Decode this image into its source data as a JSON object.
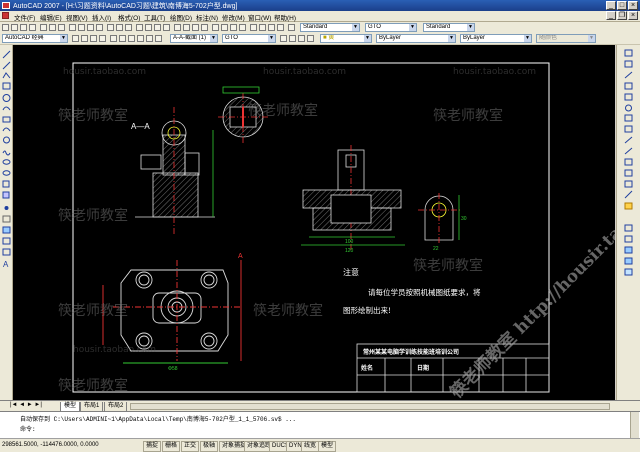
{
  "window": {
    "title": "AutoCAD 2007 - [H:\\习题资料\\AutoCAD习题\\建筑\\南博海5-702户型.dwg]",
    "buttons": [
      "_",
      "□",
      "×"
    ]
  },
  "menu": [
    "文件(F)",
    "编辑(E)",
    "视图(V)",
    "插入(I)",
    "格式(O)",
    "工具(T)",
    "绘图(D)",
    "标注(N)",
    "修改(M)",
    "窗口(W)",
    "帮助(H)"
  ],
  "toolbars": {
    "workspace": "AutoCAD 经典",
    "text_style": "Standard",
    "dim_style": "GTO",
    "table_style": "Standard",
    "layer": "0",
    "layer_state": "A-A-截面 (1)",
    "layer_current": "GTO",
    "color": "■ 黄",
    "linetype": "ByLayer",
    "lineweight": "ByLayer",
    "plotstyle": "随颜色"
  },
  "drawing": {
    "section_label": "A—A",
    "cut_marker": "A",
    "notes_title": "注意",
    "notes_line1": "请每位学员按照机械图纸要求，将",
    "notes_line2": "图形绘制出来!",
    "title_block": {
      "header": "常州某某电脑学训练技能班培训公司",
      "name_label": "姓名",
      "date_label": "日期"
    },
    "dims": {
      "plan_width": "Φ58",
      "front_width": "100",
      "front_base": "120",
      "side_width": "22",
      "side_height": "30"
    },
    "watermark_cn": "筷老师教室",
    "watermark_url": "housir.taobao.com",
    "watermark_big": "筷老师教室 http://housir.taobao.com"
  },
  "tabs": [
    "模型",
    "布局1",
    "布局2"
  ],
  "command": {
    "line1": "自动保存到 C:\\Users\\ADMINI~1\\AppData\\Local\\Temp\\南博海5-702户型_1_1_5706.sv$ ...",
    "prompt": "命令:"
  },
  "status": {
    "coords": "298561.5000, -114476.0000, 0.0000",
    "toggles": [
      "捕捉",
      "栅格",
      "正交",
      "极轴",
      "对象捕捉",
      "对象追踪",
      "DUCS",
      "DYN",
      "线宽",
      "模型"
    ]
  }
}
